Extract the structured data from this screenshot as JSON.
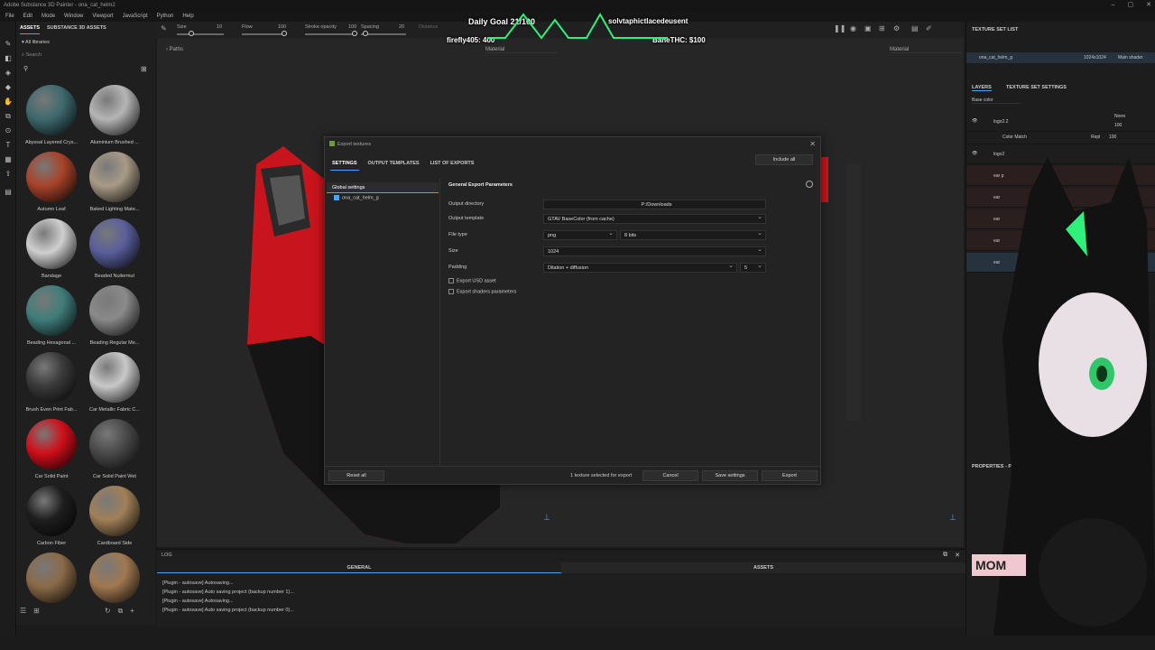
{
  "titlebar": {
    "title": "Adobe Substance 3D Painter - ona_cat_helm2"
  },
  "menubar": {
    "items": [
      "File",
      "Edit",
      "Mode",
      "Window",
      "Viewport",
      "JavaScript",
      "Python",
      "Help"
    ]
  },
  "toolbar": {
    "size_label": "Size",
    "size_value": "10",
    "flow_label": "Flow",
    "flow_value": "100",
    "stroke_opacity_label": "Stroke opacity",
    "stroke_opacity_value": "100",
    "spacing_label": "Spacing",
    "spacing_value": "20",
    "distance_label": "Distance"
  },
  "assets": {
    "tab_assets": "ASSETS",
    "tab_substance": "SUBSTANCE 3D ASSETS",
    "library": "All libraries",
    "search_placeholder": "Search",
    "materials": [
      {
        "label": "Abyssal Layered Crys...",
        "color": "#3e6a6f"
      },
      {
        "label": "Aluminium Brushed ...",
        "color": "#b5b5b5"
      },
      {
        "label": "Autumn Leaf",
        "color": "#a8432a"
      },
      {
        "label": "Baked Lighting Mate...",
        "color": "#a89a86"
      },
      {
        "label": "Bandage",
        "color": "#cfcfcf"
      },
      {
        "label": "Beaded Nuilermut",
        "color": "#5a5e9a"
      },
      {
        "label": "Beading Hexagonal ...",
        "color": "#3f7d7a"
      },
      {
        "label": "Beading Regular Me...",
        "color": "#8a8a8a"
      },
      {
        "label": "Brush Even Print Fab...",
        "color": "#3a3a3a"
      },
      {
        "label": "Car Metallic Fabric C...",
        "color": "#c8c8c8"
      },
      {
        "label": "Car Solid Paint",
        "color": "#d0101a"
      },
      {
        "label": "Car Solid Paint Wet",
        "color": "#4a4a4a"
      },
      {
        "label": "Carbon Fiber",
        "color": "#1e1e1e"
      },
      {
        "label": "Cardboard Side",
        "color": "#a08058"
      },
      {
        "label": "",
        "color": "#8a6a48"
      },
      {
        "label": "",
        "color": "#a07850"
      }
    ]
  },
  "viewport": {
    "paths_label": "Paths",
    "material_left": "Material",
    "material_right": "Material"
  },
  "stream": {
    "goal": "Daily Goal 21/100",
    "donor1": "firefly405: 400",
    "donor2": "BaneTHC: $100",
    "user": "solvtaphictlacedeusent"
  },
  "dialog": {
    "title": "Export textures",
    "tabs": [
      "SETTINGS",
      "OUTPUT TEMPLATES",
      "LIST OF EXPORTS"
    ],
    "include_all": "Include all",
    "global_settings": "Global settings",
    "texture_set": "ona_cat_helm_g",
    "section": "General Export Parameters",
    "output_directory_label": "Output directory",
    "output_directory_value": "P:/Downloads",
    "output_template_label": "Output template",
    "output_template_value": "GTAV BaseColor (from cache)",
    "file_type_label": "File type",
    "file_type_value": "png",
    "bits_value": "8 bits",
    "size_label": "Size",
    "size_value": "1024",
    "padding_label": "Padding",
    "padding_value": "Dilation + diffusion",
    "padding_amount": "5",
    "export_usd": "Export USD asset",
    "export_shaders": "Export shaders parameters",
    "reset_all": "Reset all",
    "status": "1 texture selected for export",
    "cancel": "Cancel",
    "save_settings": "Save settings",
    "export": "Export"
  },
  "log": {
    "title": "LOG",
    "tab_general": "GENERAL",
    "tab_assets": "ASSETS",
    "lines": [
      "[Plugin - autosave] Autosaving...",
      "[Plugin - autosave] Auto saving project (backup number 1)...",
      "[Plugin - autosave] Autosaving...",
      "[Plugin - autosave] Auto saving project (backup number 0)..."
    ]
  },
  "right": {
    "texture_set_list": "TEXTURE SET LIST",
    "texture_set": "ona_cat_helm_g",
    "resolution": "1024x1024",
    "shader": "Main shader",
    "layers_tab": "LAYERS",
    "tss_tab": "TEXTURE SET SETTINGS",
    "channel": "Base color",
    "layers": [
      {
        "name": "logo2.2",
        "blend": "Norm",
        "opacity": "100"
      },
      {
        "name": "Color Match",
        "blend": "Repl",
        "opacity": "100"
      },
      {
        "name": "logo2"
      },
      {
        "name": "ear p"
      },
      {
        "name": "ear"
      },
      {
        "name": "ear"
      },
      {
        "name": "ear"
      },
      {
        "name": "ear"
      }
    ],
    "properties": "PROPERTIES - PAINT",
    "mom": "MOM"
  }
}
